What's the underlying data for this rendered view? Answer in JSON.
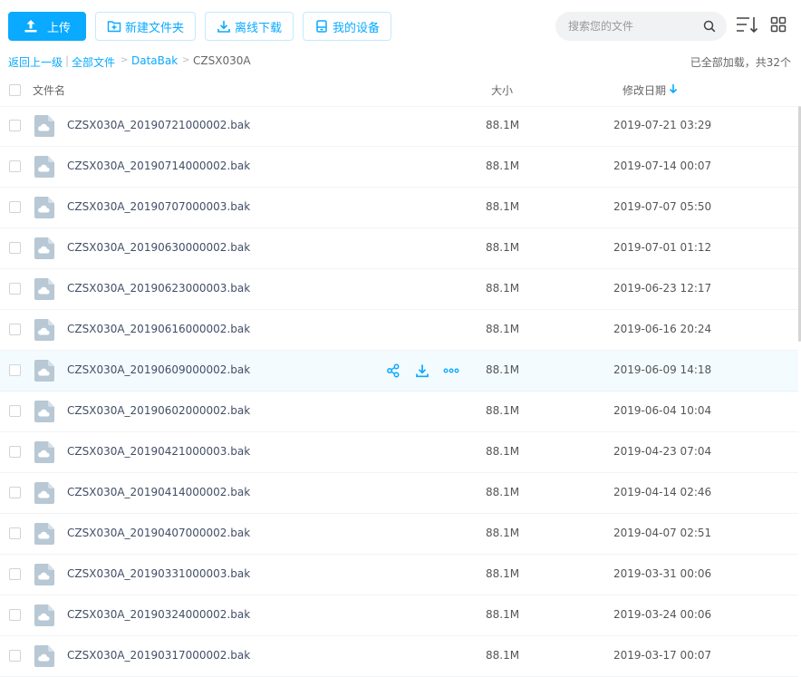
{
  "toolbar": {
    "upload_label": "上传",
    "new_folder_label": "新建文件夹",
    "offline_download_label": "离线下载",
    "my_devices_label": "我的设备",
    "search_placeholder": "搜索您的文件"
  },
  "breadcrumb": {
    "back": "返回上一级",
    "separator": "|",
    "all_files": "全部文件",
    "arrow": ">",
    "folder": "DataBak",
    "current": "CZSX030A"
  },
  "load_status": "已全部加载，共32个",
  "columns": {
    "name": "文件名",
    "size": "大小",
    "modified": "修改日期"
  },
  "colors": {
    "accent": "#09aaff",
    "row_hover": "#f4fbff",
    "file_icon": "#b8c8d4"
  },
  "icons": {
    "file": "cloud-file-icon",
    "share": "share-icon",
    "download": "download-icon",
    "more": "more-icon"
  },
  "files": [
    {
      "name": "CZSX030A_20190721000002.bak",
      "size": "88.1M",
      "modified": "2019-07-21 03:29"
    },
    {
      "name": "CZSX030A_20190714000002.bak",
      "size": "88.1M",
      "modified": "2019-07-14 00:07"
    },
    {
      "name": "CZSX030A_20190707000003.bak",
      "size": "88.1M",
      "modified": "2019-07-07 05:50"
    },
    {
      "name": "CZSX030A_20190630000002.bak",
      "size": "88.1M",
      "modified": "2019-07-01 01:12"
    },
    {
      "name": "CZSX030A_20190623000003.bak",
      "size": "88.1M",
      "modified": "2019-06-23 12:17"
    },
    {
      "name": "CZSX030A_20190616000002.bak",
      "size": "88.1M",
      "modified": "2019-06-16 20:24"
    },
    {
      "name": "CZSX030A_20190609000002.bak",
      "size": "88.1M",
      "modified": "2019-06-09 14:18",
      "hover": true
    },
    {
      "name": "CZSX030A_20190602000002.bak",
      "size": "88.1M",
      "modified": "2019-06-04 10:04"
    },
    {
      "name": "CZSX030A_20190421000003.bak",
      "size": "88.1M",
      "modified": "2019-04-23 07:04"
    },
    {
      "name": "CZSX030A_20190414000002.bak",
      "size": "88.1M",
      "modified": "2019-04-14 02:46"
    },
    {
      "name": "CZSX030A_20190407000002.bak",
      "size": "88.1M",
      "modified": "2019-04-07 02:51"
    },
    {
      "name": "CZSX030A_20190331000003.bak",
      "size": "88.1M",
      "modified": "2019-03-31 00:06"
    },
    {
      "name": "CZSX030A_20190324000002.bak",
      "size": "88.1M",
      "modified": "2019-03-24 00:06"
    },
    {
      "name": "CZSX030A_20190317000002.bak",
      "size": "88.1M",
      "modified": "2019-03-17 00:07"
    }
  ]
}
